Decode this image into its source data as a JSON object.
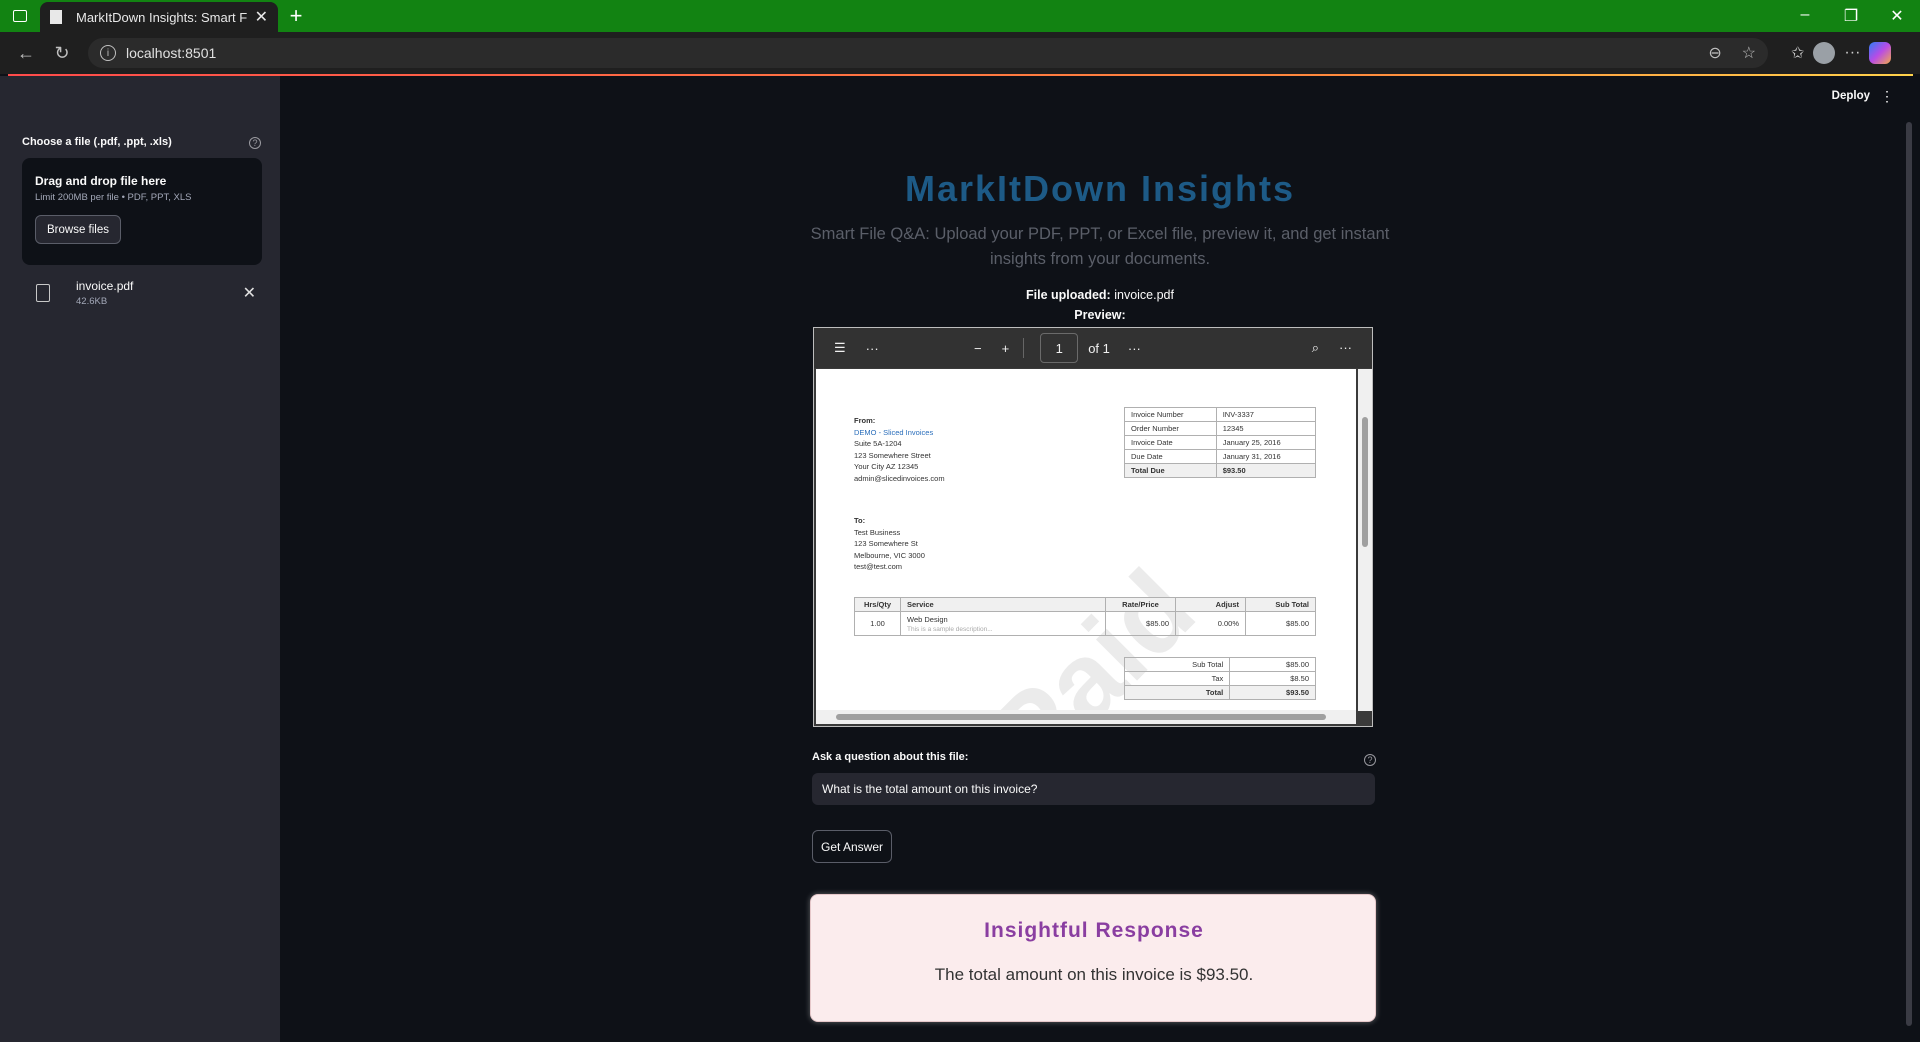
{
  "browser": {
    "tab_title": "MarkItDown Insights: Smart File Q&A",
    "url": "localhost:8501"
  },
  "header": {
    "deploy_label": "Deploy"
  },
  "sidebar": {
    "uploader_label": "Choose a file (.pdf, .ppt, .xls)",
    "dropzone_title": "Drag and drop file here",
    "dropzone_limit": "Limit 200MB per file • PDF, PPT, XLS",
    "browse_label": "Browse files",
    "file": {
      "name": "invoice.pdf",
      "size": "42.6KB"
    }
  },
  "main": {
    "title": "MarkItDown Insights",
    "subtitle": "Smart File Q&A: Upload your PDF, PPT, or Excel file, preview it, and get instant insights from your documents.",
    "uploaded_prefix": "File uploaded:",
    "uploaded_name": "invoice.pdf",
    "preview_label": "Preview:",
    "question_label": "Ask a question about this file:",
    "question_value": "What is the total amount on this invoice?",
    "get_answer_label": "Get Answer",
    "response_title": "Insightful Response",
    "response_text": "The total amount on this invoice is $93.50."
  },
  "viewer": {
    "page_number": "1",
    "page_total": "of 1"
  },
  "invoice": {
    "from_label": "From:",
    "from_company": "DEMO - Sliced Invoices",
    "from_lines": [
      "Suite 5A-1204",
      "123 Somewhere Street",
      "Your City AZ 12345",
      "admin@slicedinvoices.com"
    ],
    "to_label": "To:",
    "to_lines": [
      "Test Business",
      "123 Somewhere St",
      "Melbourne, VIC 3000",
      "test@test.com"
    ],
    "meta": [
      [
        "Invoice Number",
        "INV-3337"
      ],
      [
        "Order Number",
        "12345"
      ],
      [
        "Invoice Date",
        "January 25, 2016"
      ],
      [
        "Due Date",
        "January 31, 2016"
      ],
      [
        "Total Due",
        "$93.50"
      ]
    ],
    "items_header": [
      "Hrs/Qty",
      "Service",
      "Rate/Price",
      "Adjust",
      "Sub Total"
    ],
    "item": {
      "qty": "1.00",
      "service": "Web Design",
      "desc": "This is a sample description...",
      "rate": "$85.00",
      "adjust": "0.00%",
      "subtotal": "$85.00"
    },
    "totals": [
      [
        "Sub Total",
        "$85.00"
      ],
      [
        "Tax",
        "$8.50"
      ],
      [
        "Total",
        "$93.50"
      ]
    ],
    "watermark": "Paid"
  }
}
